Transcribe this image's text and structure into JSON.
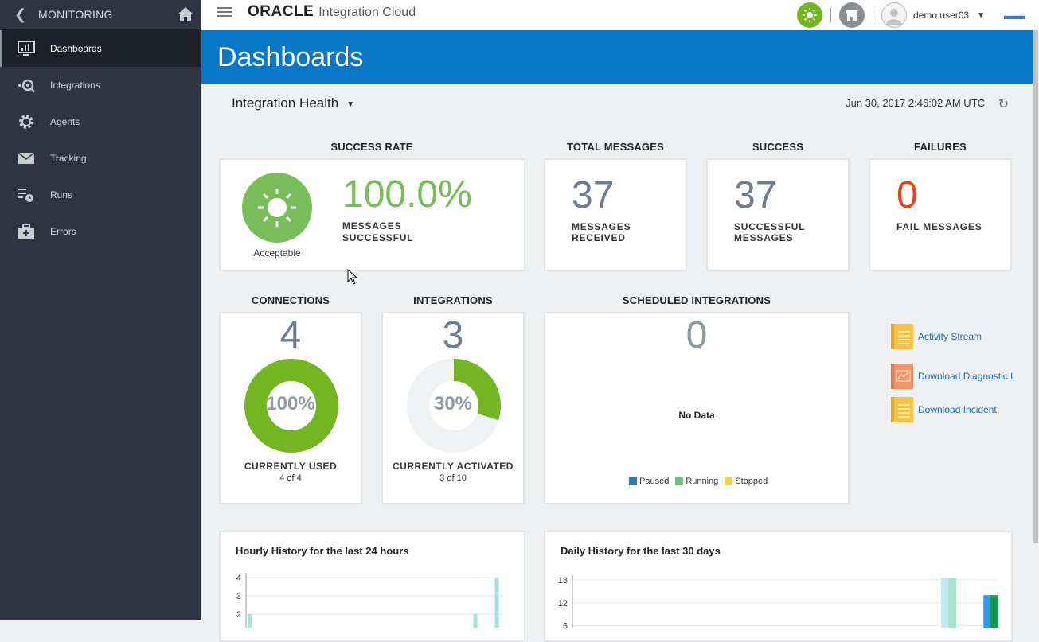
{
  "sidebar": {
    "header": "MONITORING",
    "items": [
      {
        "label": "Dashboards"
      },
      {
        "label": "Integrations"
      },
      {
        "label": "Agents"
      },
      {
        "label": "Tracking"
      },
      {
        "label": "Runs"
      },
      {
        "label": "Errors"
      }
    ]
  },
  "topbar": {
    "brand": "ORACLE",
    "product": "Integration Cloud",
    "username": "demo.user03"
  },
  "banner": {
    "title": "Dashboards"
  },
  "toolbar": {
    "selector": "Integration Health",
    "timestamp": "Jun 30, 2017 2:46:02 AM UTC"
  },
  "success_rate": {
    "title": "SUCCESS RATE",
    "status": "Acceptable",
    "value": "100.0%",
    "label_line1": "MESSAGES",
    "label_line2": "SUCCESSFUL"
  },
  "total_messages": {
    "title": "TOTAL MESSAGES",
    "value": "37",
    "label_line1": "MESSAGES",
    "label_line2": "RECEIVED"
  },
  "success": {
    "title": "SUCCESS",
    "value": "37",
    "label_line1": "SUCCESSFUL",
    "label_line2": "MESSAGES"
  },
  "failures": {
    "title": "FAILURES",
    "value": "0",
    "label_line1": "FAIL MESSAGES"
  },
  "connections": {
    "title": "CONNECTIONS",
    "value": "4",
    "percent_label": "100%",
    "fraction": 1.0,
    "caption": "CURRENTLY USED",
    "sub": "4 of 4"
  },
  "integrations": {
    "title": "INTEGRATIONS",
    "value": "3",
    "percent_label": "30%",
    "fraction": 0.3,
    "caption": "CURRENTLY ACTIVATED",
    "sub": "3 of 10"
  },
  "scheduled": {
    "title": "SCHEDULED INTEGRATIONS",
    "value": "0",
    "empty": "No Data",
    "legend": [
      {
        "label": "Paused",
        "color": "#2b7bb9"
      },
      {
        "label": "Running",
        "color": "#6cc07a"
      },
      {
        "label": "Stopped",
        "color": "#f5d04a"
      }
    ]
  },
  "links": [
    {
      "label": "Activity Stream"
    },
    {
      "label": "Download Diagnostic L"
    },
    {
      "label": "Download Incident"
    }
  ],
  "colors": {
    "accent_green": "#74b524",
    "banner_blue": "#0a76c6",
    "fail_red": "#e0471a",
    "success_green": "#79bd5b"
  },
  "hourly": {
    "title": "Hourly History for the last 24 hours",
    "chart_data": {
      "type": "bar",
      "y_ticks": [
        "4",
        "3",
        "2"
      ],
      "ylim": [
        1,
        4
      ],
      "bars": [
        {
          "slot": 0,
          "value": 2,
          "color": "#a8e2dc"
        },
        {
          "slot": 21,
          "value": 2,
          "color": "#a8e2dc"
        },
        {
          "slot": 23,
          "value": 4,
          "color": "#a8e2dc"
        }
      ],
      "slots": 24
    }
  },
  "daily": {
    "title": "Daily History for the last 30 days",
    "chart_data": {
      "type": "bar",
      "y_ticks": [
        "18",
        "12",
        "6"
      ],
      "ylim": [
        6,
        18
      ],
      "bars": [
        {
          "slot": 26,
          "value": 18.5,
          "color": "#bfe9f3"
        },
        {
          "slot": 26.5,
          "value": 18.5,
          "color": "#a8e2cf"
        },
        {
          "slot": 29,
          "value": 14,
          "color": "#2f9ee0"
        },
        {
          "slot": 29.5,
          "value": 14,
          "color": "#0e9a4e"
        }
      ],
      "slots": 30
    }
  }
}
